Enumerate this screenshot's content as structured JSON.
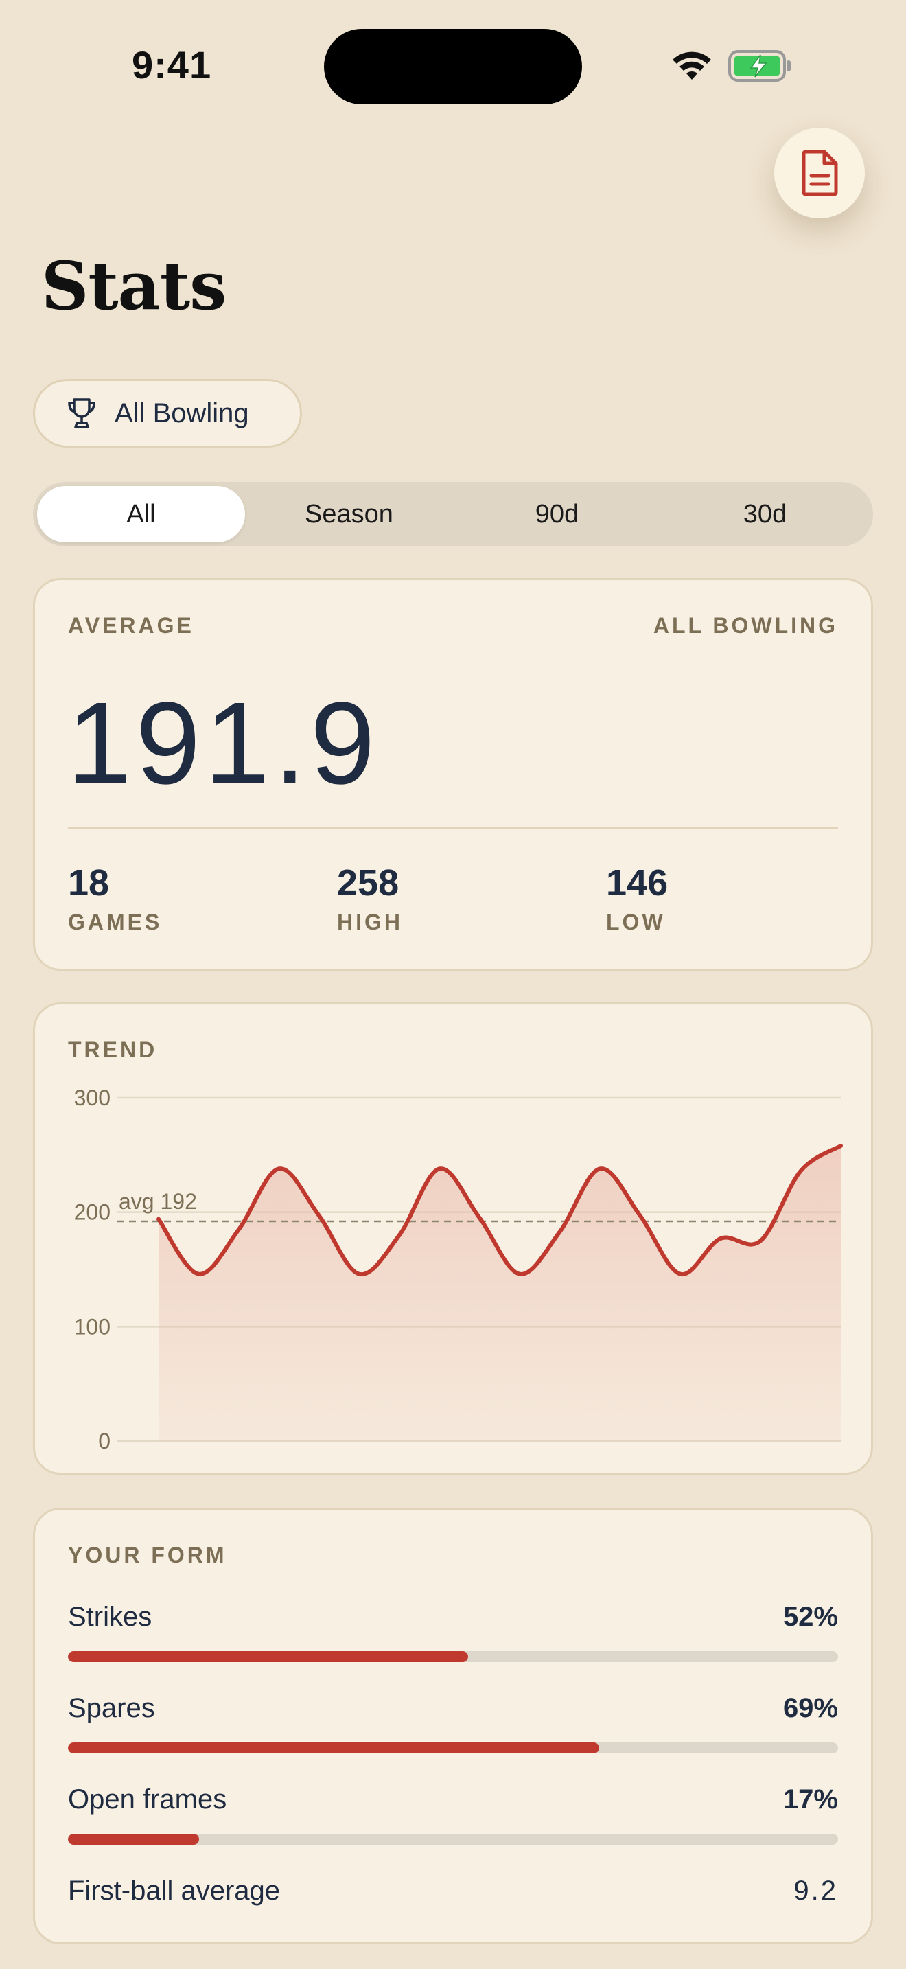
{
  "status_bar": {
    "time": "9:41"
  },
  "header": {
    "title": "Stats",
    "doc_icon": "document-icon"
  },
  "league_chip": {
    "label": "All Bowling",
    "icon": "trophy-icon"
  },
  "segments": [
    {
      "label": "All",
      "active": true
    },
    {
      "label": "Season",
      "active": false
    },
    {
      "label": "90d",
      "active": false
    },
    {
      "label": "30d",
      "active": false
    }
  ],
  "average_card": {
    "label": "AVERAGE",
    "scope": "ALL BOWLING",
    "value": "191.9",
    "stats": [
      {
        "value": "18",
        "label": "GAMES"
      },
      {
        "value": "258",
        "label": "HIGH"
      },
      {
        "value": "146",
        "label": "LOW"
      }
    ]
  },
  "trend_card": {
    "label": "TREND"
  },
  "chart_data": {
    "type": "area",
    "title": "TREND",
    "ylim": [
      0,
      300
    ],
    "yticks": [
      300,
      200,
      100,
      0
    ],
    "grid": true,
    "reference_line": {
      "value": 192,
      "label": "avg 192"
    },
    "series": [
      {
        "values": [
          194,
          146,
          185,
          238,
          197,
          146,
          180,
          238,
          195,
          146,
          183,
          238,
          197,
          146,
          177,
          175,
          236,
          258
        ]
      }
    ],
    "colors": {
      "line": "#C0392F",
      "fill": "#E9B5A6"
    }
  },
  "form_card": {
    "label": "YOUR FORM",
    "rows": [
      {
        "label": "Strikes",
        "value": "52%",
        "fraction": 0.52
      },
      {
        "label": "Spares",
        "value": "69%",
        "fraction": 0.69
      },
      {
        "label": "Open frames",
        "value": "17%",
        "fraction": 0.17
      }
    ],
    "first_ball": {
      "label": "First-ball average",
      "value": "9.2"
    }
  },
  "colors": {
    "background": "#EFE4D1",
    "card": "#F7F0E3",
    "accent": "#C0392F",
    "ink": "#1F2B40",
    "muted": "#7D6F55"
  }
}
